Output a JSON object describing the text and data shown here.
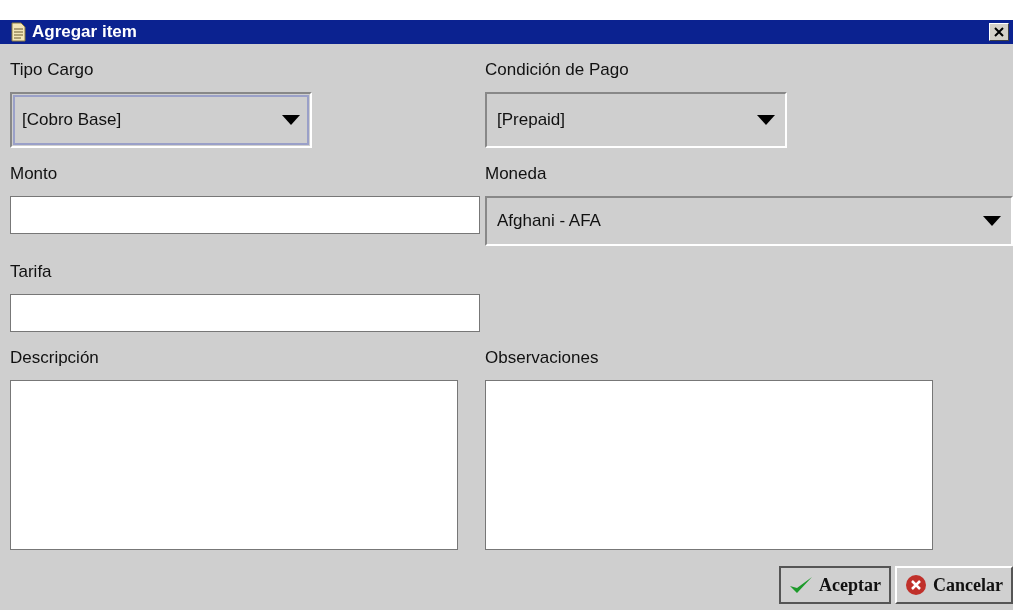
{
  "window": {
    "title": "Agregar item"
  },
  "fields": [
    {
      "label": "Tipo Cargo",
      "kind": "dropdown",
      "value": "[Cobro Base]",
      "focused": true
    },
    {
      "label": "Condición de Pago",
      "kind": "dropdown",
      "value": "[Prepaid]",
      "focused": false
    },
    {
      "label": "Monto",
      "kind": "text"
    },
    {
      "label": "Moneda",
      "kind": "wide-dropdown",
      "value": "Afghani - AFA",
      "focused": false
    },
    {
      "label": "Tarifa",
      "kind": "text"
    },
    {
      "kind": "blank"
    },
    {
      "label": "Descripción",
      "kind": "textarea"
    },
    {
      "label": "Observaciones",
      "kind": "textarea"
    }
  ],
  "buttons": [
    {
      "label": "Aceptar",
      "kind": "ok"
    },
    {
      "label": "Cancelar",
      "kind": "cancel"
    }
  ]
}
